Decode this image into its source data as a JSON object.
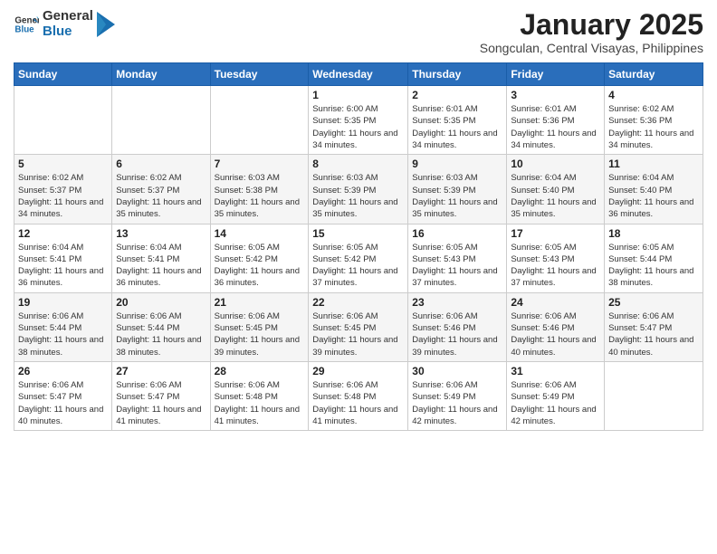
{
  "header": {
    "logo_general": "General",
    "logo_blue": "Blue",
    "month": "January 2025",
    "location": "Songculan, Central Visayas, Philippines"
  },
  "weekdays": [
    "Sunday",
    "Monday",
    "Tuesday",
    "Wednesday",
    "Thursday",
    "Friday",
    "Saturday"
  ],
  "weeks": [
    [
      null,
      null,
      null,
      {
        "day": 1,
        "sunrise": "6:00 AM",
        "sunset": "5:35 PM",
        "daylight": "11 hours and 34 minutes."
      },
      {
        "day": 2,
        "sunrise": "6:01 AM",
        "sunset": "5:35 PM",
        "daylight": "11 hours and 34 minutes."
      },
      {
        "day": 3,
        "sunrise": "6:01 AM",
        "sunset": "5:36 PM",
        "daylight": "11 hours and 34 minutes."
      },
      {
        "day": 4,
        "sunrise": "6:02 AM",
        "sunset": "5:36 PM",
        "daylight": "11 hours and 34 minutes."
      }
    ],
    [
      {
        "day": 5,
        "sunrise": "6:02 AM",
        "sunset": "5:37 PM",
        "daylight": "11 hours and 34 minutes."
      },
      {
        "day": 6,
        "sunrise": "6:02 AM",
        "sunset": "5:37 PM",
        "daylight": "11 hours and 35 minutes."
      },
      {
        "day": 7,
        "sunrise": "6:03 AM",
        "sunset": "5:38 PM",
        "daylight": "11 hours and 35 minutes."
      },
      {
        "day": 8,
        "sunrise": "6:03 AM",
        "sunset": "5:39 PM",
        "daylight": "11 hours and 35 minutes."
      },
      {
        "day": 9,
        "sunrise": "6:03 AM",
        "sunset": "5:39 PM",
        "daylight": "11 hours and 35 minutes."
      },
      {
        "day": 10,
        "sunrise": "6:04 AM",
        "sunset": "5:40 PM",
        "daylight": "11 hours and 35 minutes."
      },
      {
        "day": 11,
        "sunrise": "6:04 AM",
        "sunset": "5:40 PM",
        "daylight": "11 hours and 36 minutes."
      }
    ],
    [
      {
        "day": 12,
        "sunrise": "6:04 AM",
        "sunset": "5:41 PM",
        "daylight": "11 hours and 36 minutes."
      },
      {
        "day": 13,
        "sunrise": "6:04 AM",
        "sunset": "5:41 PM",
        "daylight": "11 hours and 36 minutes."
      },
      {
        "day": 14,
        "sunrise": "6:05 AM",
        "sunset": "5:42 PM",
        "daylight": "11 hours and 36 minutes."
      },
      {
        "day": 15,
        "sunrise": "6:05 AM",
        "sunset": "5:42 PM",
        "daylight": "11 hours and 37 minutes."
      },
      {
        "day": 16,
        "sunrise": "6:05 AM",
        "sunset": "5:43 PM",
        "daylight": "11 hours and 37 minutes."
      },
      {
        "day": 17,
        "sunrise": "6:05 AM",
        "sunset": "5:43 PM",
        "daylight": "11 hours and 37 minutes."
      },
      {
        "day": 18,
        "sunrise": "6:05 AM",
        "sunset": "5:44 PM",
        "daylight": "11 hours and 38 minutes."
      }
    ],
    [
      {
        "day": 19,
        "sunrise": "6:06 AM",
        "sunset": "5:44 PM",
        "daylight": "11 hours and 38 minutes."
      },
      {
        "day": 20,
        "sunrise": "6:06 AM",
        "sunset": "5:44 PM",
        "daylight": "11 hours and 38 minutes."
      },
      {
        "day": 21,
        "sunrise": "6:06 AM",
        "sunset": "5:45 PM",
        "daylight": "11 hours and 39 minutes."
      },
      {
        "day": 22,
        "sunrise": "6:06 AM",
        "sunset": "5:45 PM",
        "daylight": "11 hours and 39 minutes."
      },
      {
        "day": 23,
        "sunrise": "6:06 AM",
        "sunset": "5:46 PM",
        "daylight": "11 hours and 39 minutes."
      },
      {
        "day": 24,
        "sunrise": "6:06 AM",
        "sunset": "5:46 PM",
        "daylight": "11 hours and 40 minutes."
      },
      {
        "day": 25,
        "sunrise": "6:06 AM",
        "sunset": "5:47 PM",
        "daylight": "11 hours and 40 minutes."
      }
    ],
    [
      {
        "day": 26,
        "sunrise": "6:06 AM",
        "sunset": "5:47 PM",
        "daylight": "11 hours and 40 minutes."
      },
      {
        "day": 27,
        "sunrise": "6:06 AM",
        "sunset": "5:47 PM",
        "daylight": "11 hours and 41 minutes."
      },
      {
        "day": 28,
        "sunrise": "6:06 AM",
        "sunset": "5:48 PM",
        "daylight": "11 hours and 41 minutes."
      },
      {
        "day": 29,
        "sunrise": "6:06 AM",
        "sunset": "5:48 PM",
        "daylight": "11 hours and 41 minutes."
      },
      {
        "day": 30,
        "sunrise": "6:06 AM",
        "sunset": "5:49 PM",
        "daylight": "11 hours and 42 minutes."
      },
      {
        "day": 31,
        "sunrise": "6:06 AM",
        "sunset": "5:49 PM",
        "daylight": "11 hours and 42 minutes."
      },
      null
    ]
  ],
  "labels": {
    "sunrise_prefix": "Sunrise: ",
    "sunset_prefix": "Sunset: ",
    "daylight_prefix": "Daylight: "
  }
}
